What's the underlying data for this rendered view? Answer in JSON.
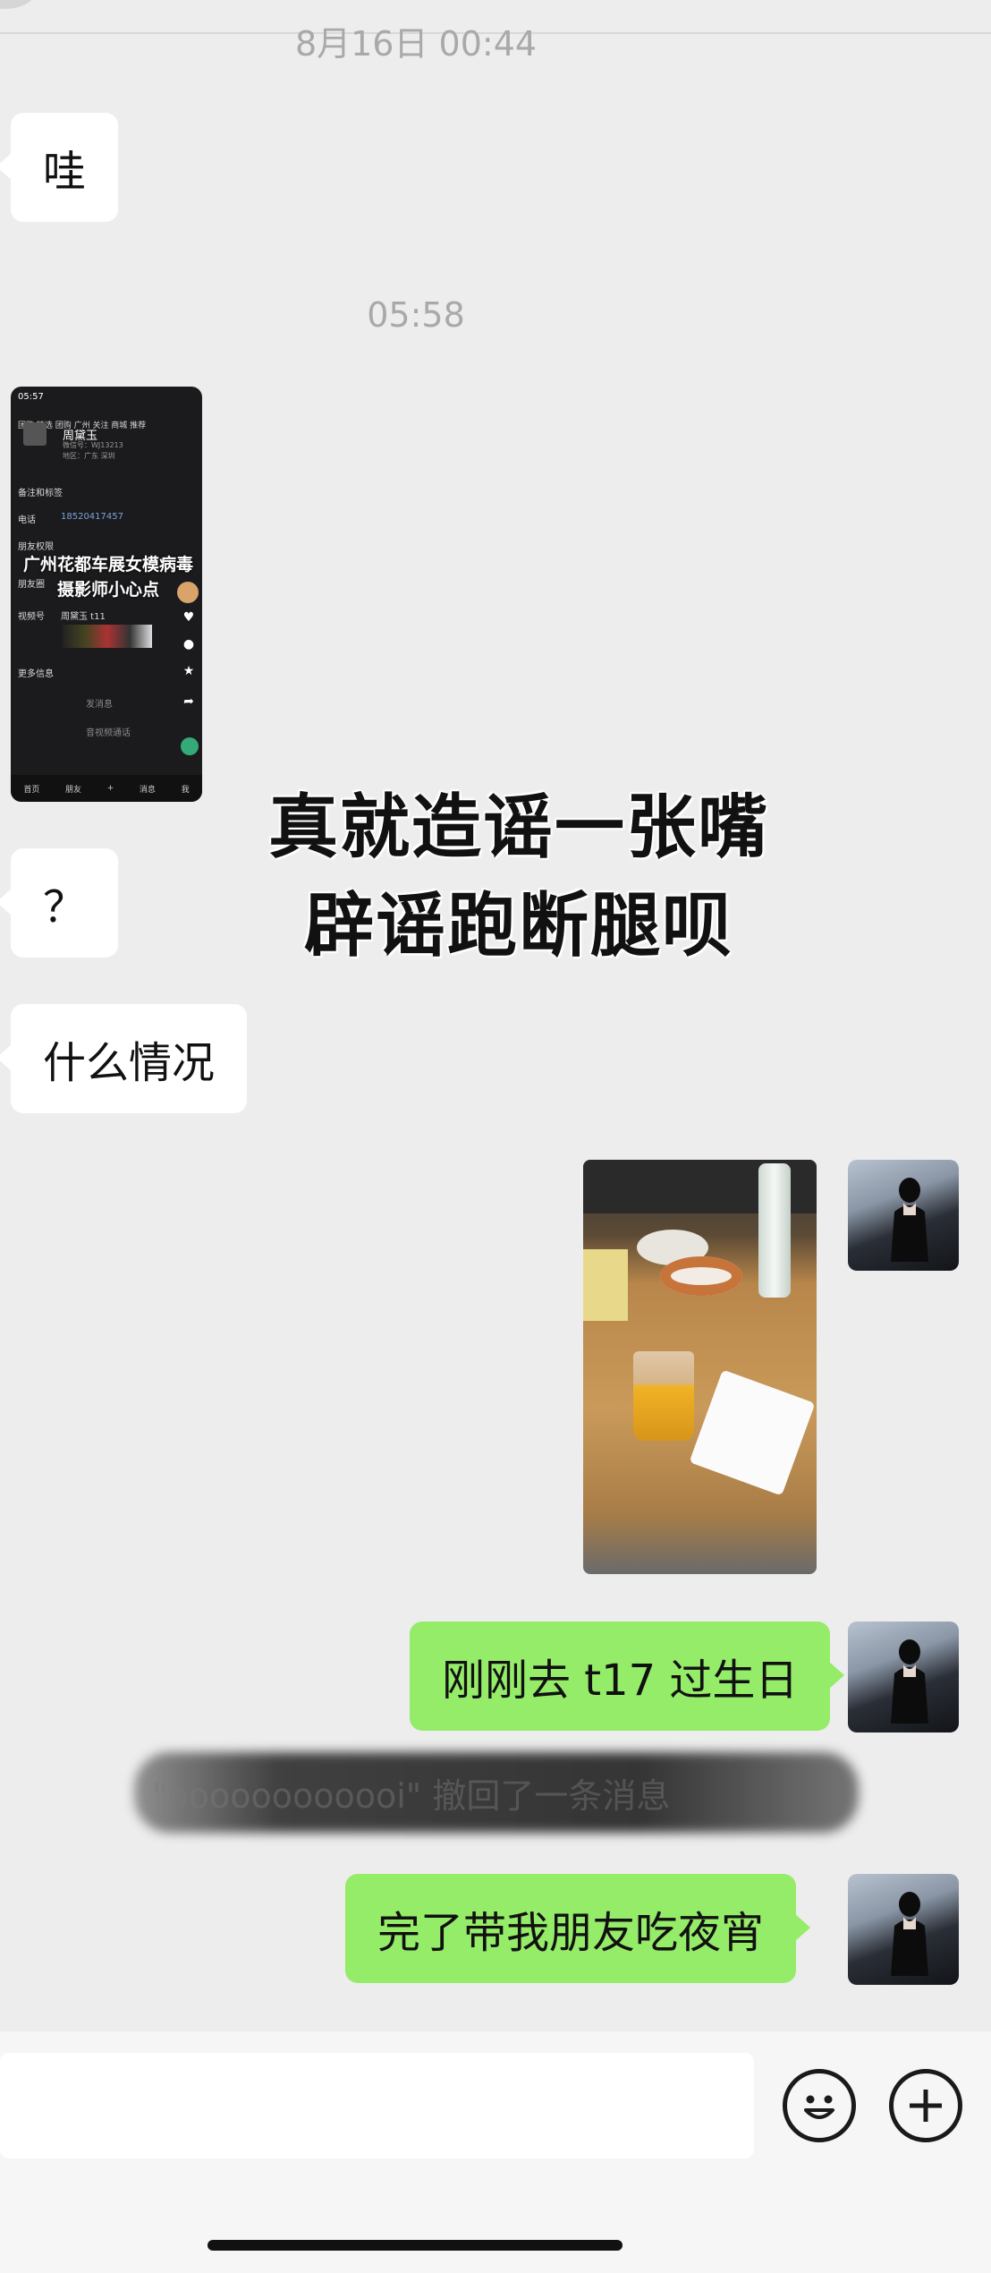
{
  "timestamps": [
    "8月16日 00:44",
    "05:58"
  ],
  "messages": {
    "m1": "哇",
    "m2": "？",
    "m3": "什么情况",
    "m4": "刚刚去 t17 过生日",
    "m5": "完了带我朋友吃夜宵"
  },
  "recall_notice": "\"oooooooooooi\" 撤回了一条消息",
  "overlay_caption": {
    "line1": "真就造谣一张嘴",
    "line2": "辟谣跑断腿呗"
  },
  "screenshot_thumb": {
    "time": "05:57",
    "tabs": "团购  精选  团购  广州  关注  商城  推荐",
    "name": "周黛玉",
    "wechat_id": "微信号：WJ13213",
    "region": "地区：广东 深圳",
    "remark_label": "备注和标签",
    "phone_label": "电话",
    "phone_value": "18520417457",
    "permission_label": "朋友权限",
    "moments_label": "朋友圈",
    "channels_label": "视频号",
    "channels_value": "周黛玉 t11",
    "more_label": "更多信息",
    "send_msg": "发消息",
    "video_call": "音视频通话",
    "overlay_line1": "广州花都车展女模病毒",
    "overlay_line2": "摄影师小心点",
    "nav": [
      "首页",
      "朋友",
      "+",
      "消息",
      "我"
    ]
  },
  "icons": [
    "emoji-icon",
    "plus-icon"
  ],
  "colors": {
    "outgoing_bubble": "#95ec69",
    "incoming_bubble": "#ffffff",
    "background": "#ededed"
  }
}
